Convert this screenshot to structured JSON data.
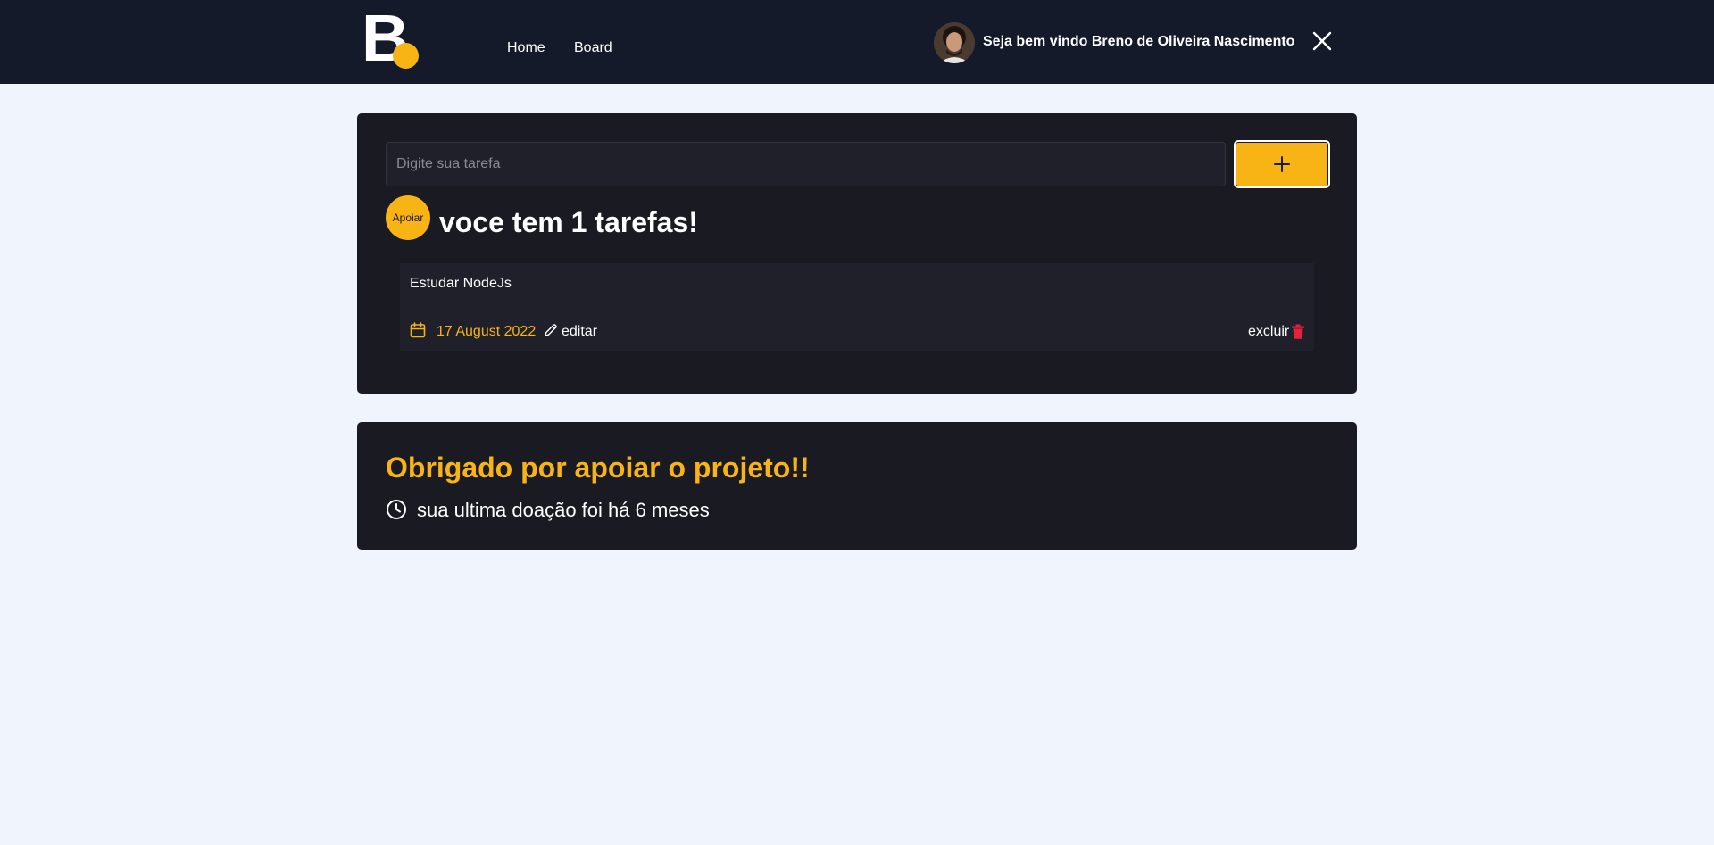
{
  "header": {
    "logo_text": "B",
    "nav": [
      {
        "label": "Home"
      },
      {
        "label": "Board"
      }
    ],
    "welcome_text": "Seja bem vindo Breno de Oliveira Nascimento"
  },
  "task_form": {
    "input_placeholder": "Digite sua tarefa",
    "input_value": "",
    "add_button_icon": "plus-icon"
  },
  "support_button_label": "Apoiar",
  "task_count_text": "voce tem 1 tarefas!",
  "tasks": [
    {
      "title": "Estudar NodeJs",
      "date": "17 August 2022",
      "edit_label": "editar",
      "delete_label": "excluir"
    }
  ],
  "support": {
    "title": "Obrigado por apoiar o projeto!!",
    "last_donation": "sua ultima doação foi há 6 meses"
  },
  "colors": {
    "header_bg": "#141a2a",
    "page_bg": "#f0f4fc",
    "card_bg": "#1a1a22",
    "accent": "#f8b314",
    "danger": "#e8203a"
  }
}
